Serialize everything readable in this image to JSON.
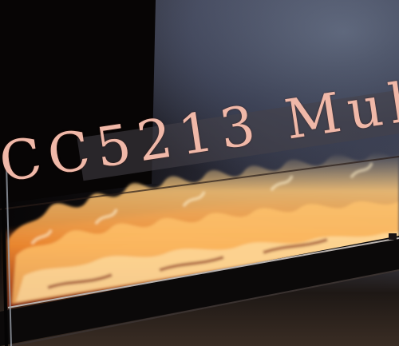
{
  "caption": {
    "text": "CC5213 Mul"
  },
  "colors": {
    "caption_text": "#f0b8a8",
    "flame_core": "#ffd38a",
    "flame_mid": "#f08a30",
    "flame_edge": "#a8361a",
    "frame": "#0b0909"
  },
  "icons": {
    "fire": "fire-icon"
  }
}
